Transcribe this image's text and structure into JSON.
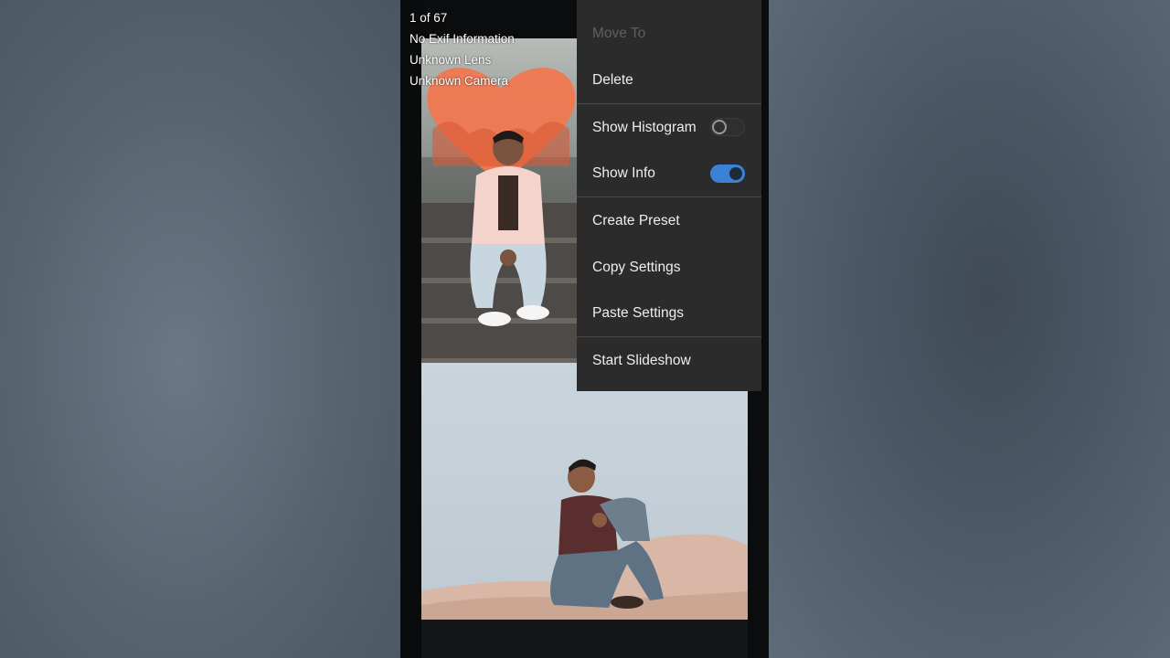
{
  "photo_info": {
    "counter": "1 of 67",
    "exif": "No Exif Information",
    "lens": "Unknown Lens",
    "camera": "Unknown Camera"
  },
  "menu": {
    "move_to": "Move To",
    "delete": "Delete",
    "show_histogram": {
      "label": "Show Histogram",
      "on": false
    },
    "show_info": {
      "label": "Show Info",
      "on": true
    },
    "create_preset": "Create Preset",
    "copy_settings": "Copy Settings",
    "paste_settings": "Paste Settings",
    "start_slideshow": "Start Slideshow"
  },
  "colors": {
    "menu_bg": "#2b2b2b",
    "toggle_on": "#3b82d6",
    "heart": "#f07850"
  }
}
